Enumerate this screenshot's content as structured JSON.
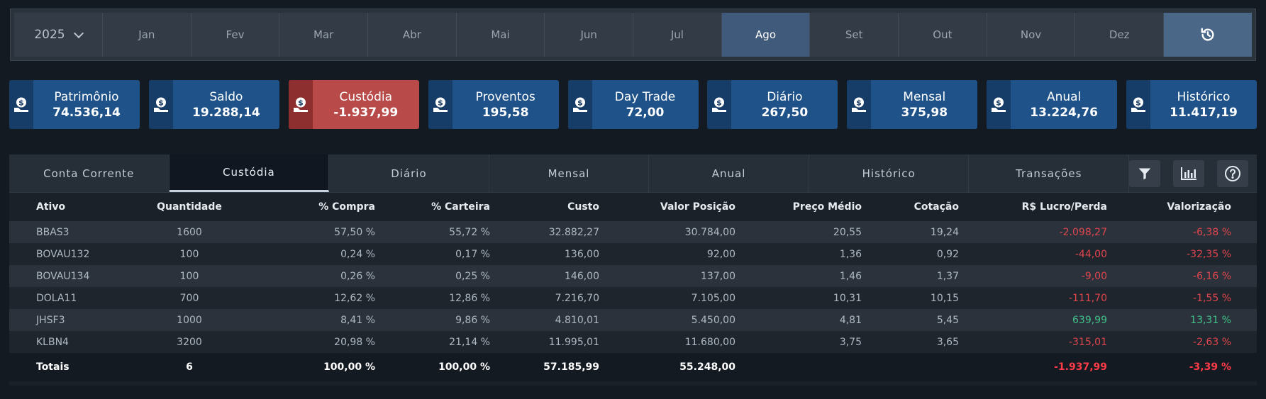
{
  "colors": {
    "accent": "#1f5288",
    "negative": "#e0454d",
    "positive": "#3fc28a",
    "active_month": "#3f5a7a"
  },
  "period": {
    "year": "2025",
    "months": [
      "Jan",
      "Fev",
      "Mar",
      "Abr",
      "Mai",
      "Jun",
      "Jul",
      "Ago",
      "Set",
      "Out",
      "Nov",
      "Dez"
    ],
    "active_month": "Ago"
  },
  "cards": [
    {
      "label": "Patrimônio",
      "value": "74.536,14",
      "icon": "money-hand-icon"
    },
    {
      "label": "Saldo",
      "value": "19.288,14",
      "icon": "money-hand-icon"
    },
    {
      "label": "Custódia",
      "value": "-1.937,99",
      "icon": "money-hand-icon",
      "status": "negative"
    },
    {
      "label": "Proventos",
      "value": "195,58",
      "icon": "money-hand-icon"
    },
    {
      "label": "Day Trade",
      "value": "72,00",
      "icon": "money-hand-icon"
    },
    {
      "label": "Diário",
      "value": "267,50",
      "icon": "money-hand-icon"
    },
    {
      "label": "Mensal",
      "value": "375,98",
      "icon": "money-hand-icon"
    },
    {
      "label": "Anual",
      "value": "13.224,76",
      "icon": "money-hand-icon"
    },
    {
      "label": "Histórico",
      "value": "11.417,19",
      "icon": "money-hand-icon"
    }
  ],
  "tabs": [
    "Conta Corrente",
    "Custódia",
    "Diário",
    "Mensal",
    "Anual",
    "Histórico",
    "Transações"
  ],
  "active_tab": "Custódia",
  "tools": [
    "filter-icon",
    "bar-chart-icon",
    "help-icon"
  ],
  "table": {
    "headers": [
      "Ativo",
      "Quantidade",
      "% Compra",
      "% Carteira",
      "Custo",
      "Valor Posição",
      "Preço Médio",
      "Cotação",
      "R$ Lucro/Perda",
      "Valorização"
    ],
    "rows": [
      [
        "BBAS3",
        "1600",
        "57,50 %",
        "55,72 %",
        "32.882,27",
        "30.784,00",
        "20,55",
        "19,24",
        "-2.098,27",
        "-6,38 %"
      ],
      [
        "BOVAU132",
        "100",
        "0,24 %",
        "0,17 %",
        "136,00",
        "92,00",
        "1,36",
        "0,92",
        "-44,00",
        "-32,35 %"
      ],
      [
        "BOVAU134",
        "100",
        "0,26 %",
        "0,25 %",
        "146,00",
        "137,00",
        "1,46",
        "1,37",
        "-9,00",
        "-6,16 %"
      ],
      [
        "DOLA11",
        "700",
        "12,62 %",
        "12,86 %",
        "7.216,70",
        "7.105,00",
        "10,31",
        "10,15",
        "-111,70",
        "-1,55 %"
      ],
      [
        "JHSF3",
        "1000",
        "8,41 %",
        "9,86 %",
        "4.810,01",
        "5.450,00",
        "4,81",
        "5,45",
        "639,99",
        "13,31 %"
      ],
      [
        "KLBN4",
        "3200",
        "20,98 %",
        "21,14 %",
        "11.995,01",
        "11.680,00",
        "3,75",
        "3,65",
        "-315,01",
        "-2,63 %"
      ]
    ],
    "totals": [
      "Totais",
      "6",
      "100,00 %",
      "100,00 %",
      "57.185,99",
      "55.248,00",
      "",
      "",
      "-1.937,99",
      "-3,39 %"
    ]
  }
}
